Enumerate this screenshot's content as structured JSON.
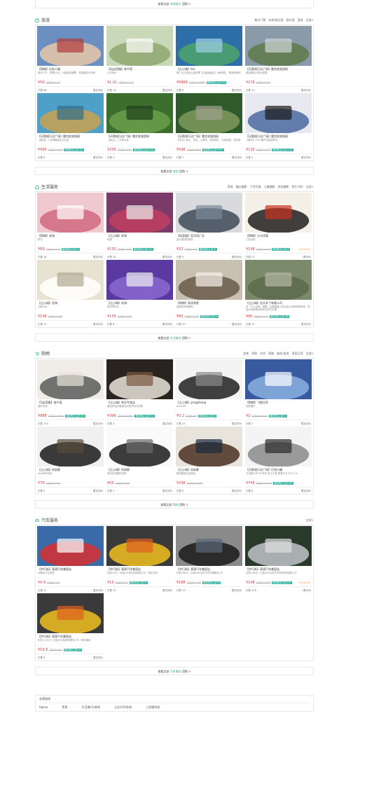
{
  "top_more": {
    "prefix": "查看全部",
    "cat": "休闲娱乐",
    "suffix": "团购 >"
  },
  "sections": [
    {
      "title": "旅游",
      "tabs": [
        "景点门票",
        "本地/周边游",
        "国内游",
        "漂流",
        "全部>"
      ],
      "more": {
        "prefix": "查看全部",
        "cat": "旅游",
        "suffix": "团购 >"
      },
      "cards": [
        {
          "title": "【购物】红彩小福",
          "desc": "原价170，仅需50元，七国游玩通票，享超值游乐体验",
          "price": "¥50",
          "old": "门店价 ¥170",
          "tag": "",
          "stars": "",
          "sold": "已售 68",
          "rate": "暂无评价"
        },
        {
          "title": "【玩店西路】老乡搭",
          "desc": "公开特价",
          "price": "¥1.01",
          "old": "门店价 ¥1.01",
          "tag": "",
          "stars": "",
          "sold": "已售 10",
          "rate": "暂无评价"
        },
        {
          "title": "【之心城】fee",
          "desc": "厦门九日游含往返机票【五星级酒店】全程领队，畅游鼓浪屿",
          "price": "¥9888",
          "old": "门店价 ¥9999",
          "tag": "微信购买立减 ¥40",
          "stars": "",
          "sold": "已售 6",
          "rate": "暂无评价"
        },
        {
          "title": "【天鹅湖万达广场】雷克发旅游网",
          "desc": "漫游梯田小镇水墨图",
          "price": "¥178",
          "old": "门店价 ¥210",
          "tag": "",
          "stars": "",
          "sold": "已售 13",
          "rate": "暂无评价"
        },
        {
          "title": "【天鹅湖万达广场】雷克发旅游网",
          "desc": "【春游】三亚海南精品五日游",
          "price": "¥490",
          "old": "门店价 ¥590",
          "tag": "微信购买立减 ¥40",
          "stars": "",
          "sold": "已售 6",
          "rate": "暂无评价"
        },
        {
          "title": "【天鹅湖万达广场】雷克发旅游网",
          "desc": "【黄山】三天黄山游",
          "price": "¥258",
          "old": "门店价 ¥310",
          "tag": "微信购买立减 ¥258",
          "stars": "",
          "sold": "已售 4",
          "rate": "暂无评价"
        },
        {
          "title": "【天鹅湖万达广场】雷克发旅游网",
          "desc": "【华东】黄山、苏杭、九寨沟、桂林漓江、屯溪老街、宏村游",
          "price": "¥598",
          "old": "门店价 ¥650",
          "tag": "微信购买立减 ¥550",
          "stars": "",
          "sold": "已售 7",
          "rate": "暂无评价"
        },
        {
          "title": "【天鹅湖万达广场】雷克发旅游网",
          "desc": "【春节】2015春节出国游特价",
          "price": "¥126",
          "old": "门店价 ¥150",
          "tag": "微信购买立减 ¥118",
          "stars": "",
          "sold": "已售 1",
          "rate": "暂无评价"
        }
      ]
    },
    {
      "title": "生活服务",
      "tabs": [
        "家政",
        "婚纱摄影",
        "个性写真",
        "儿童摄影",
        "其他摄影",
        "照片冲印",
        "全部>"
      ],
      "more": {
        "prefix": "查看全部",
        "cat": "生活服务",
        "suffix": "团购 >"
      },
      "cards": [
        {
          "title": "【购物】花海",
          "desc": "鲜花",
          "price": "¥89",
          "old": "门店价 ¥100",
          "tag": "微信购买立减 ¥2",
          "stars": "",
          "sold": "已售 16",
          "rate": "暂无评价"
        },
        {
          "title": "【之心城】花海",
          "desc": "玫瑰",
          "price": "¥150",
          "old": "门店价 ¥200",
          "tag": "微信购买立减 ¥10",
          "stars": "",
          "sold": "已售 10",
          "rate": "暂无评价"
        },
        {
          "title": "【低容器】亚木用广告",
          "desc": "金大湖回收服务",
          "price": "¥12",
          "old": "门店价 ¥15",
          "tag": "微信购买立减 ¥1",
          "stars": "",
          "sold": "已售 5",
          "rate": "暂无评价"
        },
        {
          "title": "【购物】大众优惠",
          "desc": "门优优惠",
          "price": "¥198",
          "old": "门店价 ¥200",
          "tag": "微信购买立减 ¥5",
          "stars": "★★★★★",
          "sold": "已售 23",
          "rate": "1条评价"
        },
        {
          "title": "【之心城】花海",
          "desc": "万能卡社",
          "price": "¥136",
          "old": "门店价 ¥300",
          "tag": "",
          "stars": "",
          "sold": "已售 15",
          "rate": "暂无评价"
        },
        {
          "title": "【之心城】花海",
          "desc": "薰衣草标花",
          "price": "¥139",
          "old": "门店价 ¥300",
          "tag": "",
          "stars": "",
          "sold": "已售 8",
          "rate": "暂无评价"
        },
        {
          "title": "【购物】测试商家",
          "desc": "金鑫商务局团购",
          "price": "¥80",
          "old": "门店价 ¥120",
          "tag": "微信购买立减 ¥2",
          "stars": "",
          "sold": "已售 10",
          "rate": "暂无评价"
        },
        {
          "title": "【之心城】名天米了有限公司",
          "desc": "在「行心连项」梯图，合肥国营公司活动大天和他物线场，然后应该继续找到本日的打合理",
          "price": "¥90",
          "old": "门店价 ¥120",
          "tag": "微信购买立减 ¥80",
          "stars": "",
          "sold": "已售 15",
          "rate": "暂无评价"
        }
      ]
    },
    {
      "title": "购物",
      "tabs": [
        "女装",
        "男装",
        "内衣",
        "鞋靴",
        "箱包/皮具",
        "家居日用",
        "全部>"
      ],
      "more": {
        "prefix": "查看全部",
        "cat": "购物",
        "suffix": "团购 >"
      },
      "cards": [
        {
          "title": "【3店西路】老乡搭",
          "desc": "国风字画",
          "price": "¥888",
          "old": "门店价 ¥8000",
          "tag": "微信购买立减 ¥10",
          "stars": "",
          "sold": "已售 104",
          "rate": "暂无评价"
        },
        {
          "title": "【之心城】刻乐专卖店",
          "desc": "套组床品多套装优化西宗特价的更",
          "price": "¥398",
          "old": "门店价 ¥2680",
          "tag": "微信购买立减 ¥10",
          "stars": "",
          "sold": "已售 4",
          "rate": "暂无评价"
        },
        {
          "title": "【之心城】yangzhong",
          "desc": "iphone6",
          "price": "¥0.2",
          "old": "门店价 ¥0",
          "tag": "微信购买立减 ¥0",
          "stars": "",
          "sold": "已售 15",
          "rate": "暂无评价"
        },
        {
          "title": "【购物】飞就天声",
          "desc": "全新国行",
          "price": "¥2",
          "old": "门店价 ¥6000",
          "tag": "微信购买立减 ¥1",
          "stars": "",
          "sold": "已售 7",
          "rate": "暂无评价"
        },
        {
          "title": "【之心城】尚安都",
          "desc": "dixe商务皮夹",
          "price": "¥79",
          "old": "门店价 ¥518",
          "tag": "",
          "stars": "",
          "sold": "已售 5",
          "rate": "暂无评价"
        },
        {
          "title": "【之心城】尚安都",
          "desc": "真皮实用腰扣皮带",
          "price": "¥55",
          "old": "门店价 ¥269",
          "tag": "",
          "stars": "",
          "sold": "已售 5",
          "rate": "暂无评价"
        },
        {
          "title": "【之心城】尚安都",
          "desc": "服饰箱款包含保包",
          "price": "¥298",
          "old": "门店价 ¥1088",
          "tag": "",
          "stars": "",
          "sold": "已售 5",
          "rate": "暂无评价"
        },
        {
          "title": "【天鹅湖万达广场】灯泡小编",
          "desc": "卡西欧EDIFICE系列 男士手表 腕表EFR-527L-1A",
          "price": "¥745",
          "old": "门店价 ¥1490",
          "tag": "微信购买立减 ¥20",
          "stars": "",
          "sold": "已售 8",
          "rate": "暂无评价"
        }
      ]
    },
    {
      "title": "汽车服务",
      "tabs": [
        "全部>"
      ],
      "more": {
        "prefix": "查看全部",
        "cat": "汽车服务",
        "suffix": "团购 >"
      },
      "cards": [
        {
          "title": "【步行街】滴滴汽车美容店",
          "desc": "车辆全方位清洗",
          "price": "¥9.9",
          "old": "门店价 ¥20",
          "tag": "",
          "stars": "",
          "sold": "已售 21",
          "rate": "暂无评价"
        },
        {
          "title": "【步行街】滴滴汽车美容店",
          "desc": "仅售19元！价值25元的洗车服务1次，周末可用",
          "price": "¥19",
          "old": "门店价 ¥25",
          "tag": "微信购买立减 ¥1",
          "stars": "",
          "sold": "已售 10",
          "rate": "暂无评价"
        },
        {
          "title": "【步行街】滴滴汽车美容店",
          "desc": "仅售188元！价值208元的汽车打蜡服务1次",
          "price": "¥188",
          "old": "门店价 ¥208",
          "tag": "微信购买立减 ¥3",
          "stars": "",
          "sold": "已售 19",
          "rate": "暂无评价"
        },
        {
          "title": "【步行街】滴滴汽车美容店",
          "desc": "仅售148元！价值300元的汽车内饰清洗服务1次",
          "price": "¥148",
          "old": "门店价 ¥300",
          "tag": "微信购买立减 ¥20",
          "stars": "★★★★★",
          "sold": "已售 218",
          "rate": "1条评价"
        },
        {
          "title": "【步行街】滴滴汽车美容店",
          "desc": "仅售19.8元！价值38元的精洗服务1次，周末通用",
          "price": "¥19.8",
          "old": "门店价 ¥38",
          "tag": "微信购买立减 ¥5",
          "stars": "",
          "sold": "已售 6",
          "rate": "暂无评价"
        }
      ]
    }
  ],
  "friend_links": {
    "title": "友情链接",
    "items": [
      "Kgmw",
      "黑哥",
      "生活通c2c新闻",
      "企业O2O系统",
      "三网通系统"
    ]
  },
  "colors": {
    "accent": "#2aaf9c",
    "price": "#e4393c"
  }
}
